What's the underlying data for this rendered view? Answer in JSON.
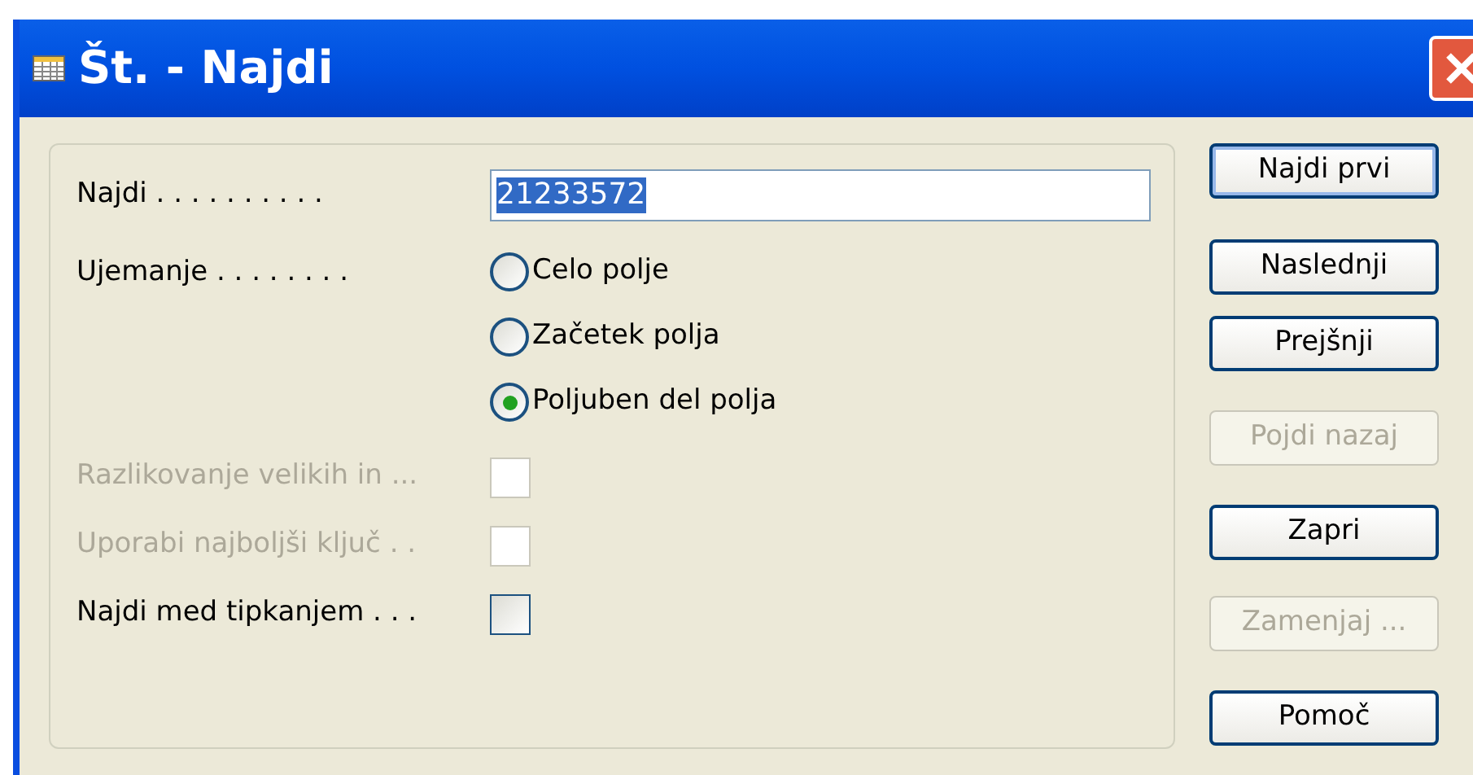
{
  "window": {
    "title": "Št. - Najdi"
  },
  "find_field": {
    "label": "Najdi . . . . . . . . . .",
    "value": "21233572",
    "value_selected": true
  },
  "match": {
    "label": "Ujemanje . . . . . . . .",
    "options": [
      {
        "label": "Celo polje",
        "selected": false
      },
      {
        "label": "Začetek polja",
        "selected": false
      },
      {
        "label": "Poljuben del polja",
        "selected": true
      }
    ]
  },
  "checkboxes": [
    {
      "label": "Razlikovanje velikih in ...",
      "checked": false,
      "disabled": true
    },
    {
      "label": "Uporabi najboljši ključ . .",
      "checked": false,
      "disabled": true
    },
    {
      "label": "Najdi med tipkanjem . . .",
      "checked": false,
      "disabled": false
    }
  ],
  "buttons": [
    {
      "label": "Najdi prvi",
      "disabled": false,
      "default": true
    },
    {
      "label": "Naslednji",
      "disabled": false,
      "default": false
    },
    {
      "label": "Prejšnji",
      "disabled": false,
      "default": false
    },
    {
      "label": "Pojdi nazaj",
      "disabled": true,
      "default": false
    },
    {
      "label": "Zapri",
      "disabled": false,
      "default": false
    },
    {
      "label": "Zamenjaj ...",
      "disabled": true,
      "default": false
    },
    {
      "label": "Pomoč",
      "disabled": false,
      "default": false
    }
  ]
}
